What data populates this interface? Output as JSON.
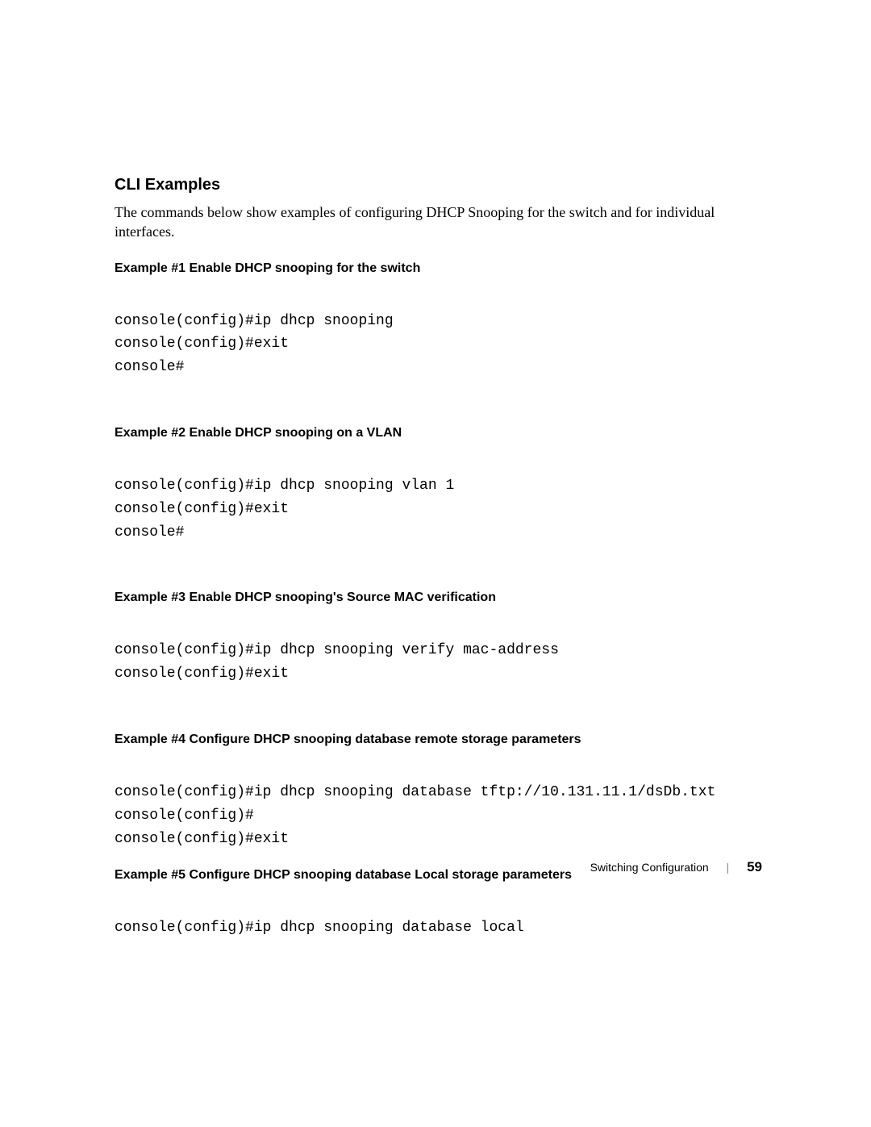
{
  "section_title": "CLI Examples",
  "intro": "The commands below show examples of configuring DHCP Snooping for the switch and for individual interfaces.",
  "examples": [
    {
      "title": "Example #1 Enable DHCP snooping for the switch",
      "code": "console(config)#ip dhcp snooping\nconsole(config)#exit\nconsole#"
    },
    {
      "title": "Example #2 Enable DHCP snooping on a VLAN",
      "code": "console(config)#ip dhcp snooping vlan 1\nconsole(config)#exit\nconsole#"
    },
    {
      "title": "Example #3 Enable DHCP snooping's Source MAC verification",
      "code": "console(config)#ip dhcp snooping verify mac-address\nconsole(config)#exit"
    },
    {
      "title": "Example #4 Configure DHCP snooping database remote storage parameters",
      "code": "console(config)#ip dhcp snooping database tftp://10.131.11.1/dsDb.txt\nconsole(config)#\nconsole(config)#exit"
    },
    {
      "title": "Example #5 Configure DHCP snooping database Local storage parameters",
      "code": "console(config)#ip dhcp snooping database local"
    }
  ],
  "footer": {
    "section": "Switching Configuration",
    "page": "59"
  }
}
